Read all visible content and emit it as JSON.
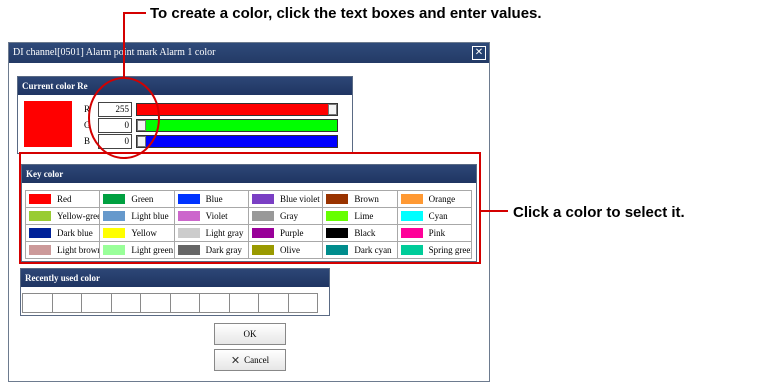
{
  "annotations": {
    "top": "To create a color, click the text boxes and enter values.",
    "right": "Click a color to select it."
  },
  "dialog": {
    "title": "DI channel[0501] Alarm point mark Alarm 1 color",
    "close_icon": "close-icon"
  },
  "current_color": {
    "header": "Current color Re",
    "preview_color": "#ff0000",
    "r_label": "R",
    "g_label": "G",
    "b_label": "B",
    "r_value": "255",
    "g_value": "0",
    "b_value": "0",
    "r_level": 1.0,
    "g_level": 0.0,
    "b_level": 0.0
  },
  "key_color": {
    "header": "Key color",
    "items": [
      {
        "name": "Red",
        "color": "#ff0000"
      },
      {
        "name": "Green",
        "color": "#00a040"
      },
      {
        "name": "Blue",
        "color": "#0033ff"
      },
      {
        "name": "Blue violet",
        "color": "#7a3fc4"
      },
      {
        "name": "Brown",
        "color": "#993300"
      },
      {
        "name": "Orange",
        "color": "#ff9933"
      },
      {
        "name": "Yellow-green",
        "color": "#99cc33"
      },
      {
        "name": "Light blue",
        "color": "#6699cc"
      },
      {
        "name": "Violet",
        "color": "#cc66cc"
      },
      {
        "name": "Gray",
        "color": "#999999"
      },
      {
        "name": "Lime",
        "color": "#66ff00"
      },
      {
        "name": "Cyan",
        "color": "#00ffff"
      },
      {
        "name": "Dark blue",
        "color": "#002299"
      },
      {
        "name": "Yellow",
        "color": "#ffff00"
      },
      {
        "name": "Light gray",
        "color": "#cccccc"
      },
      {
        "name": "Purple",
        "color": "#990099"
      },
      {
        "name": "Black",
        "color": "#000000"
      },
      {
        "name": "Pink",
        "color": "#ff0099"
      },
      {
        "name": "Light brown",
        "color": "#cc9999"
      },
      {
        "name": "Light green",
        "color": "#99ff99"
      },
      {
        "name": "Dark gray",
        "color": "#666666"
      },
      {
        "name": "Olive",
        "color": "#999900"
      },
      {
        "name": "Dark cyan",
        "color": "#008c8c"
      },
      {
        "name": "Spring green",
        "color": "#00cc99"
      }
    ]
  },
  "recent": {
    "header": "Recently used color",
    "slots": 10
  },
  "buttons": {
    "ok": "OK",
    "cancel": "Cancel"
  },
  "colors": {
    "annotation_red": "#d40000",
    "header_blue": "#233a66"
  }
}
